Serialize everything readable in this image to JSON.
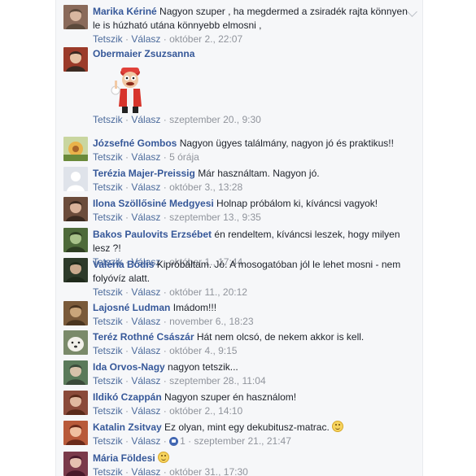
{
  "ui": {
    "like": "Tetszik",
    "reply": "Válasz",
    "dot": "·"
  },
  "comments": [
    {
      "author": "Marika Kériné",
      "text": "Nagyon szuper , ha megdermed a zsiradék rajta könnyen le is húzható utána könnyebb elmosni ,",
      "time": "október 2., 22:07",
      "avatar": "avatar-photo"
    },
    {
      "author": "Obermaier Zsuzsanna",
      "text": "",
      "time": "szeptember 20., 9:30",
      "avatar": "avatar-photo",
      "sticker": "cartoon-character-sticker"
    },
    {
      "author": "Józsefné Gombos",
      "text": "Nagyon ügyes találmány, nagyon jó és praktikus!!",
      "time": "5 órája",
      "avatar": "flower-avatar"
    },
    {
      "author": "Terézia Majer-Preissig",
      "text": "Már használtam. Nagyon jó.",
      "time": "október 3., 13:28",
      "avatar": "default-avatar"
    },
    {
      "author": "Ilona Szöllősiné Medgyesi",
      "text": "Holnap próbálom ki, kíváncsi vagyok!",
      "time": "szeptember 13., 9:35",
      "avatar": "avatar-photo"
    },
    {
      "author": "Bakos Paulovits Erzsébet",
      "text": "én rendeltem, kíváncsi leszek, hogy milyen lesz ?!",
      "time": "október 1., 17:44",
      "avatar": "avatar-photo"
    },
    {
      "author": "Valéria Bódis",
      "text": "Kipróbáltam. Jó. A mosogatóban jól le lehet mosni - nem folyóvíz alatt.",
      "time": "október 11., 20:12",
      "avatar": "avatar-photo"
    },
    {
      "author": "Lajosné Ludman",
      "text": "Imádom!!!",
      "time": "november 6., 18:23",
      "avatar": "avatar-photo"
    },
    {
      "author": "Teréz Rothné Császár",
      "text": "Hát nem olcsó, de nekem akkor is kell.",
      "time": "október 4., 9:15",
      "avatar": "dog-avatar"
    },
    {
      "author": "Ida Orvos-Nagy",
      "text": "nagyon tetszik...",
      "time": "szeptember 28., 11:04",
      "avatar": "avatar-photo"
    },
    {
      "author": "Ildikó Czappán",
      "text": "Nagyon szuper én használom!",
      "time": "október 2., 14:10",
      "avatar": "avatar-photo"
    },
    {
      "author": "Katalin Zsitvay",
      "text": "Ez olyan, mint egy dekubitusz-matrac.",
      "time": "szeptember 21., 21:47",
      "avatar": "avatar-photo",
      "emoji": "smile-emoji",
      "likes": "1"
    },
    {
      "author": "Mária Földesi",
      "text": "",
      "time": "október 31., 17:30",
      "avatar": "avatar-photo",
      "emoji": "smile-emoji"
    }
  ],
  "colors": {
    "panel": "#f6f7f9",
    "author": "#365899",
    "action": "#4b6a9b",
    "meta": "#90949c"
  }
}
